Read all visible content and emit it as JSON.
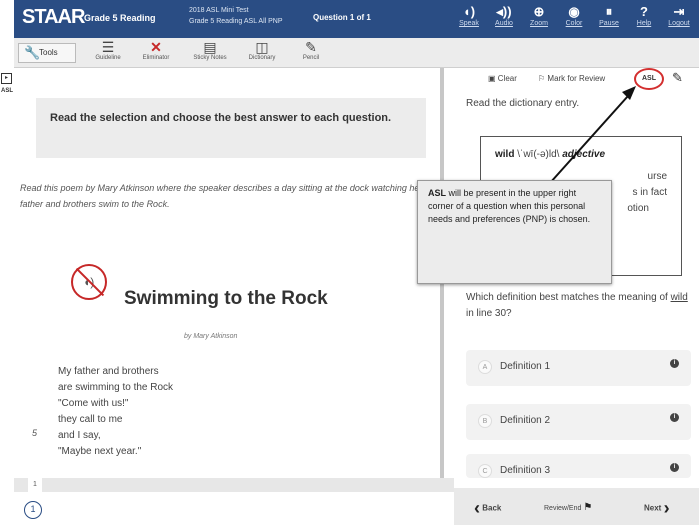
{
  "header": {
    "brand": "STAAR",
    "grade": "Grade 5 Reading",
    "test_line1": "2018 ASL Mini Test",
    "test_line2": "Grade 5 Reading ASL All PNP",
    "question_count": "Question 1 of 1",
    "buttons": [
      {
        "label": "Speak",
        "icon": "speaker-icon"
      },
      {
        "label": "Audio",
        "icon": "audio-icon"
      },
      {
        "label": "Zoom",
        "icon": "zoom-icon"
      },
      {
        "label": "Color",
        "icon": "eye-icon"
      },
      {
        "label": "Pause",
        "icon": "pause-icon"
      },
      {
        "label": "Help",
        "icon": "help-icon"
      },
      {
        "label": "Logout",
        "icon": "logout-icon"
      }
    ],
    "color": "#2a4d84"
  },
  "toolbar": {
    "tools_label": "Tools",
    "items": [
      {
        "label": "Guideline",
        "icon": "guideline-icon"
      },
      {
        "label": "Eliminator",
        "icon": "eliminator-icon"
      },
      {
        "label": "Sticky Notes",
        "icon": "sticky-notes-icon"
      },
      {
        "label": "Dictionary",
        "icon": "dictionary-icon"
      },
      {
        "label": "Pencil",
        "icon": "pencil-icon"
      }
    ]
  },
  "left_strip": {
    "label": "ASL"
  },
  "passage": {
    "instruction": "Read the selection and choose the best answer to each question.",
    "intro": "Read this poem by Mary Atkinson where the speaker describes a day sitting at the dock watching her father and brothers swim to the Rock.",
    "title": "Swimming to the Rock",
    "byline": "by Mary Atkinson",
    "lines": [
      "My father and brothers",
      "are swimming to the Rock",
      "\"Come with us!\"",
      "they call to me",
      "and I say,",
      "\"Maybe next year.\""
    ],
    "line_number": "5"
  },
  "question": {
    "clear_label": "Clear",
    "mark_label": "Mark for Review",
    "asl_label": "ASL",
    "intro": "Read the dictionary entry.",
    "dict_headword": "wild",
    "dict_pron": " \\ˈwī(-ə)ld\\ ",
    "dict_pos": "adjective",
    "dict_frag1": "urse",
    "dict_frag2": "s in fact",
    "dict_frag3": "otion",
    "stem_a": "Which definition best matches the meaning of ",
    "stem_word": "wild",
    "stem_b": " in line 30?",
    "choices": [
      {
        "letter": "A",
        "text": "Definition 1"
      },
      {
        "letter": "B",
        "text": "Definition 2"
      },
      {
        "letter": "C",
        "text": "Definition 3"
      }
    ]
  },
  "callout": {
    "bold": "ASL",
    "text": " will be present in the upper right corner of a question when this personal needs and preferences (PNP) is chosen."
  },
  "bottom": {
    "page_tab": "1",
    "page_circle": "1",
    "back_label": "Back",
    "review_label": "Review/End",
    "next_label": "Next"
  }
}
